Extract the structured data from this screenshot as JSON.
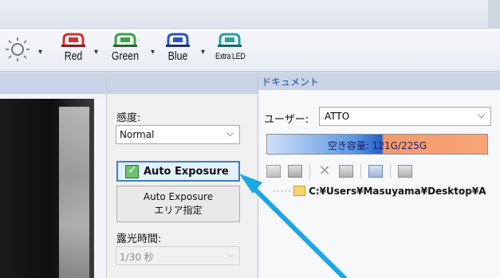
{
  "toolbar": {
    "items": [
      {
        "label": "",
        "icon": "brightness-icon"
      },
      {
        "label": "Red",
        "icon": "red-led-icon",
        "color": "#d92f2f"
      },
      {
        "label": "Green",
        "icon": "green-led-icon",
        "color": "#3aa346"
      },
      {
        "label": "Blue",
        "icon": "blue-led-icon",
        "color": "#2c56b8"
      },
      {
        "label": "Extra LED",
        "icon": "extra-led-icon",
        "color": "#23a3a3"
      }
    ],
    "dropdown_glyph": "▾"
  },
  "camera": {
    "sensitivity_label": "感度:",
    "sensitivity_value": "Normal",
    "auto_exposure_label": "Auto Exposure",
    "auto_exposure_checked": true,
    "area_button_line1": "Auto Exposure",
    "area_button_line2": "エリア指定",
    "exposure_time_label": "露光時間:",
    "exposure_time_value": "1/30 秒"
  },
  "document": {
    "title": "ドキュメント",
    "user_label": "ユーザー:",
    "user_value": "ATTO",
    "capacity_text": "空き容量: 121G/225G",
    "path": "C:¥Users¥Masuyama¥Desktop¥A"
  },
  "colors": {
    "accent": "#3c7fc4",
    "arrow": "#1aa7e6"
  }
}
